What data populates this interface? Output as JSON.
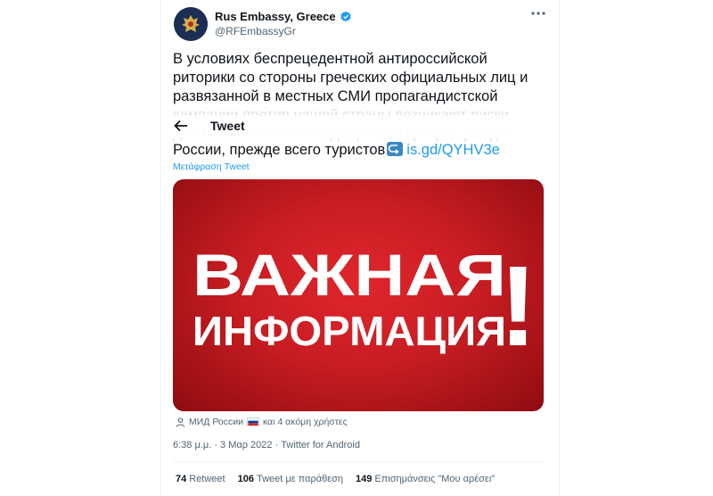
{
  "account": {
    "name": "Rus Embassy, Greece",
    "handle": "@RFEmbassyGr"
  },
  "tweet": {
    "lines": [
      "В условиях беспрецедентной антироссийской",
      "риторики со стороны греческих официальных лиц и",
      "развязанной в местных СМИ пропагандистской",
      "кампании против нашей страны возникают риски",
      "для безопасности находящихся в Греции граждан"
    ],
    "last_line": "России, прежде всего туристов",
    "link": "is.gd/QYHV3e",
    "translate_label": "Μετάφραση Tweet"
  },
  "overlay": {
    "title": "Tweet"
  },
  "media": {
    "line1": "ВАЖНАЯ",
    "line2": "ИНФОРМАЦИЯ",
    "exclamation": "!",
    "background_color": "#c81d23"
  },
  "tags": {
    "tagged_user": "МИД России",
    "others": "και 4 ακόμη χρήστες"
  },
  "meta": {
    "timestamp": "6:38 μ.μ. · 3 Μαρ 2022 · Twitter for Android"
  },
  "stats": {
    "retweets_count": "74",
    "retweets_label": "Retweet",
    "quotes_count": "106",
    "quotes_label": "Tweet με παράθεση",
    "likes_count": "149",
    "likes_label": "Επισημάνσεις \"Μου αρέσει\""
  },
  "colors": {
    "link": "#1d9bf0",
    "verified": "#1d9bf0",
    "text": "#0f1419",
    "muted": "#536471"
  }
}
